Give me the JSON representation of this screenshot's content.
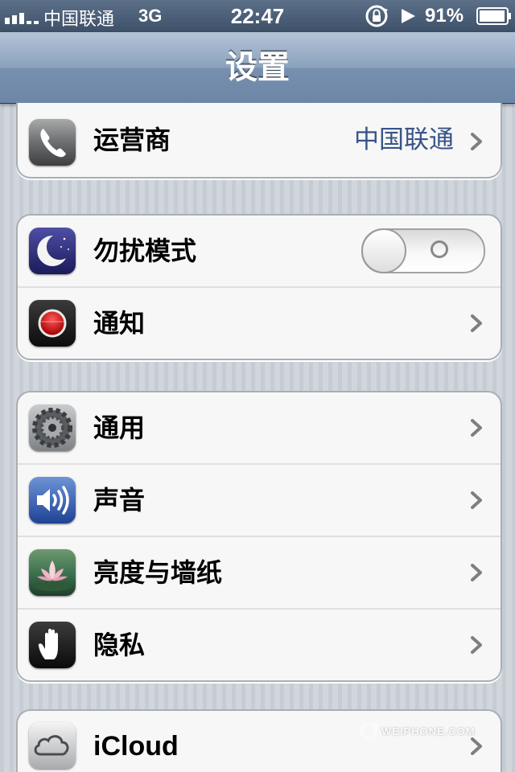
{
  "status_bar": {
    "carrier": "中国联通",
    "network": "3G",
    "time": "22:47",
    "battery": "91%"
  },
  "nav_bar": {
    "title": "设置"
  },
  "groups": [
    [
      {
        "icon": "phone-icon",
        "label": "运营商",
        "value": "中国联通",
        "accessory": "chevron"
      }
    ],
    [
      {
        "icon": "moon-icon",
        "label": "勿扰模式",
        "accessory": "toggle",
        "toggle_on": false
      },
      {
        "icon": "notification-icon",
        "label": "通知",
        "accessory": "chevron"
      }
    ],
    [
      {
        "icon": "gear-icon",
        "label": "通用",
        "accessory": "chevron"
      },
      {
        "icon": "speaker-icon",
        "label": "声音",
        "accessory": "chevron"
      },
      {
        "icon": "lotus-icon",
        "label": "亮度与墙纸",
        "accessory": "chevron"
      },
      {
        "icon": "hand-icon",
        "label": "隐私",
        "accessory": "chevron"
      }
    ],
    [
      {
        "icon": "cloud-icon",
        "label": "iCloud",
        "accessory": "chevron"
      }
    ]
  ],
  "watermark": {
    "text": "WEIPHONE.COM"
  },
  "colors": {
    "status_bar": "#4a5d76",
    "nav_bar": "#8ba1bc",
    "value_text": "#385487",
    "page_background": "#cbd2d8"
  }
}
